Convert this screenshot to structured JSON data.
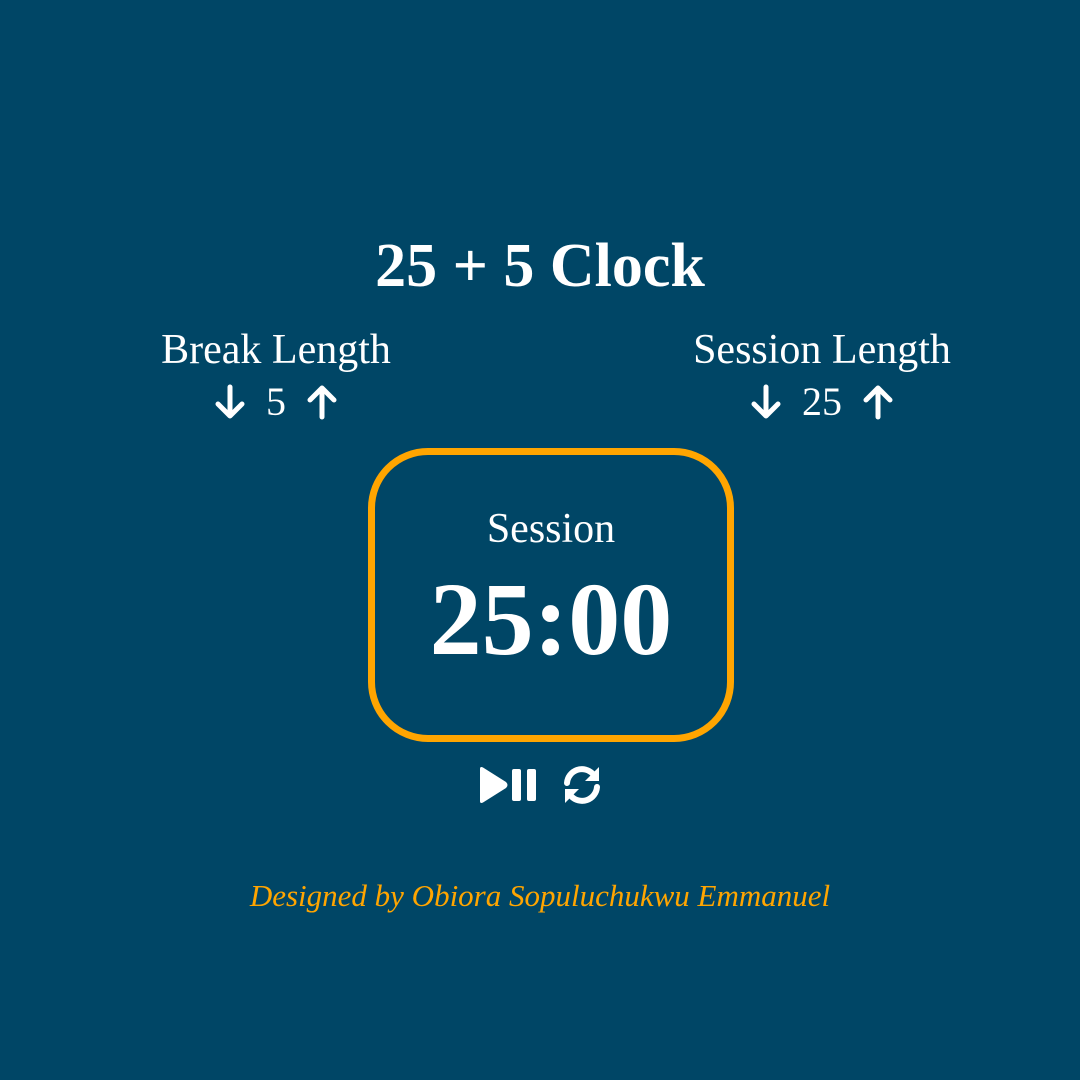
{
  "app": {
    "title": "25 + 5 Clock"
  },
  "break": {
    "label": "Break Length",
    "value": "5",
    "decrement_icon": "arrow-down-icon",
    "increment_icon": "arrow-up-icon"
  },
  "session": {
    "label": "Session Length",
    "value": "25",
    "decrement_icon": "arrow-down-icon",
    "increment_icon": "arrow-up-icon"
  },
  "timer": {
    "label": "Session",
    "time": "25:00",
    "border_color": "#ffa500"
  },
  "controls": {
    "play_pause_icon": "play-pause-icon",
    "reset_icon": "refresh-icon"
  },
  "footer": {
    "credit": "Designed by Obiora Sopuluchukwu Emmanuel"
  },
  "colors": {
    "background": "#004666",
    "accent": "#ffa500",
    "text": "#ffffff"
  }
}
